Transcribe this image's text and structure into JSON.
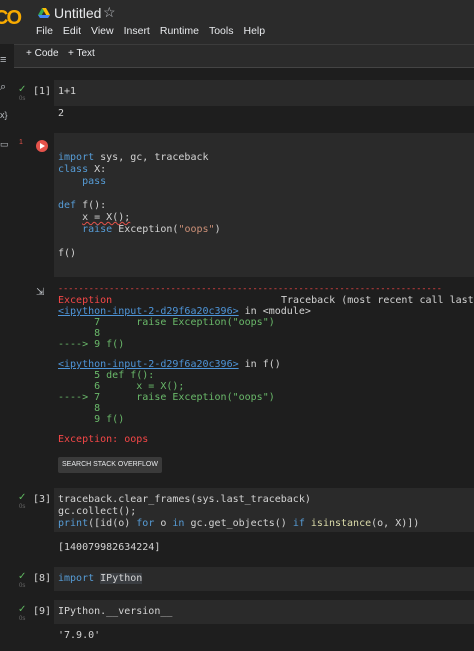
{
  "app": {
    "logo": "CO",
    "title": "Untitled"
  },
  "menu": [
    "File",
    "Edit",
    "View",
    "Insert",
    "Runtime",
    "Tools",
    "Help"
  ],
  "toolbar": {
    "code_label": "+ Code",
    "text_label": "+ Text"
  },
  "rail": {
    "menu_icon": "≡",
    "search_icon": "⌕",
    "vars_icon": "{x}",
    "files_icon": "▭"
  },
  "cells": {
    "c1": {
      "prompt": "[1]",
      "code": "1+1",
      "output": "2",
      "time": "0s"
    },
    "c2": {
      "badge": "1",
      "code": [
        "import sys, gc, traceback",
        "class X:",
        "    pass",
        "",
        "def f():",
        "    x = X();",
        "    raise Exception(\"oops\")",
        "",
        "f()"
      ],
      "traceback": {
        "rule": "---------------------------------------------------------------------------",
        "exception": "Exception",
        "header_right": "Traceback (most recent call last)",
        "frame1_link": "<ipython-input-2-d29f6a20c396>",
        "frame1_ctx": " in <module>",
        "f1_l7": "      7      raise Exception(\"oops\")",
        "f1_l8": "      8",
        "f1_arrow": "----> 9 f()",
        "frame2_link": "<ipython-input-2-d29f6a20c396>",
        "frame2_ctx": " in f()",
        "f2_l5": "      5 def f():",
        "f2_l6": "      6      x = X();",
        "f2_arrow": "----> 7      raise Exception(\"oops\")",
        "f2_l8": "      8",
        "f2_l9": "      9 f()",
        "final": "Exception: oops"
      },
      "so_button": "SEARCH STACK OVERFLOW"
    },
    "c3": {
      "prompt": "[3]",
      "code": [
        "traceback.clear_frames(sys.last_traceback)",
        "gc.collect();",
        "print([id(o) for o in gc.get_objects() if isinstance(o, X)])"
      ],
      "output": "[140079982634224]",
      "time": "0s"
    },
    "c8": {
      "prompt": "[8]",
      "code": "import IPython",
      "time": "0s"
    },
    "c9": {
      "prompt": "[9]",
      "code": "IPython.__version__",
      "output": "'7.9.0'",
      "time": "0s"
    }
  },
  "colors": {
    "accent": "#f9ab00",
    "error": "#e5534b",
    "success": "#5fb860",
    "link": "#4e95d9"
  }
}
